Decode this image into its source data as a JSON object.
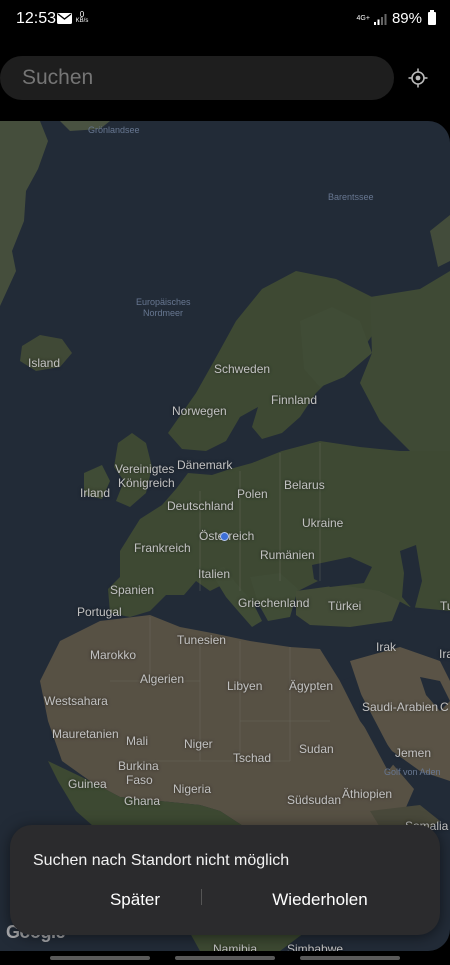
{
  "status_bar": {
    "time": "12:53",
    "rate_value": "0",
    "rate_unit": "KB/s",
    "network_label": "4G+",
    "battery": "89%",
    "mail_icon": "mail-icon"
  },
  "search": {
    "placeholder": "Suchen"
  },
  "map": {
    "labels": {
      "groenlandsee": "Grönlandsee",
      "barentssee": "Barentssee",
      "europaeisches_nordmeer_1": "Europäisches",
      "europaeisches_nordmeer_2": "Nordmeer",
      "island": "Island",
      "schweden": "Schweden",
      "finnland": "Finnland",
      "norwegen": "Norwegen",
      "vk_1": "Vereinigtes",
      "vk_2": "Königreich",
      "daenemark": "Dänemark",
      "irland": "Irland",
      "polen": "Polen",
      "belarus": "Belarus",
      "deutschland": "Deutschland",
      "ukraine": "Ukraine",
      "oesterreich": "Österreich",
      "frankreich": "Frankreich",
      "rumaenien": "Rumänien",
      "italien": "Italien",
      "spanien": "Spanien",
      "portugal": "Portugal",
      "griechenland": "Griechenland",
      "tuerkei": "Türkei",
      "tu": "Tu",
      "tunesien": "Tunesien",
      "marokko": "Marokko",
      "algerien": "Algerien",
      "irak": "Irak",
      "ira": "Ira",
      "libyen": "Libyen",
      "aegypten": "Ägypten",
      "westsahara": "Westsahara",
      "saudi_arabien": "Saudi-Arabien",
      "c": "C",
      "mauretanien": "Mauretanien",
      "mali": "Mali",
      "niger": "Niger",
      "sudan": "Sudan",
      "jemen": "Jemen",
      "tschad": "Tschad",
      "burkina_1": "Burkina",
      "burkina_2": "Faso",
      "golf_von_aden": "Golf von Aden",
      "guinea": "Guinea",
      "nigeria": "Nigeria",
      "ghana": "Ghana",
      "suedsudan": "Südsudan",
      "aethiopien": "Äthiopien",
      "somalia": "Somalia",
      "namibia": "Namibia",
      "simbabwe": "Simbabwe"
    },
    "google_logo": "Google"
  },
  "snackbar": {
    "message": "Suchen nach Standort nicht möglich",
    "later_label": "Später",
    "retry_label": "Wiederholen"
  },
  "colors": {
    "sea": "#2a3544",
    "land": "#4c5a3f",
    "desert": "#6b6354",
    "snackbar_bg": "#2b2b2d",
    "location_dot": "#3c6fd8"
  }
}
